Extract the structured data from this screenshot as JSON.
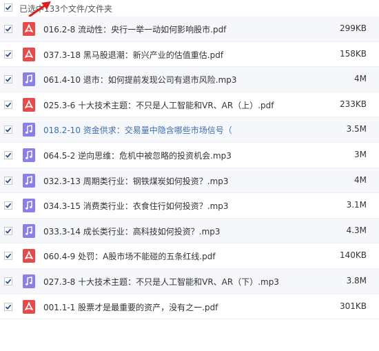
{
  "header": {
    "title": "已选中133个文件/文件夹"
  },
  "colors": {
    "pdf": "#e64a4a",
    "mp3": "#8b7ee8",
    "check": "#2a4b8d",
    "arrow": "#e01b1b"
  },
  "files": [
    {
      "name": "016.2-8 流动性：央行一举一动如何影响股市.pdf",
      "size": "299KB",
      "type": "pdf",
      "icon": "pdf-icon"
    },
    {
      "name": "037.3-18 黑马股退潮：新兴产业的估值重估.pdf",
      "size": "158KB",
      "type": "pdf",
      "icon": "pdf-icon"
    },
    {
      "name": "061.4-10 退市：如何提前发现公司有退市风险.mp3",
      "size": "4M",
      "type": "mp3",
      "icon": "music-note-icon"
    },
    {
      "name": "025.3-6 十大技术主题：不只是人工智能和VR、AR（上）.pdf",
      "size": "233KB",
      "type": "pdf",
      "icon": "pdf-icon"
    },
    {
      "name": "018.2-10 资金供求：交易量中隐含哪些市场信号（",
      "size": "3.5M",
      "type": "mp3",
      "icon": "music-note-icon"
    },
    {
      "name": "064.5-2 逆向思维：危机中被忽略的投资机会.mp3",
      "size": "3M",
      "type": "mp3",
      "icon": "music-note-icon"
    },
    {
      "name": "032.3-13 周期类行业：钢铁煤炭如何投资？.mp3",
      "size": "4M",
      "type": "mp3",
      "icon": "music-note-icon"
    },
    {
      "name": "034.3-15 消费类行业：衣食住行如何投资？.mp3",
      "size": "3.1M",
      "type": "mp3",
      "icon": "music-note-icon"
    },
    {
      "name": "033.3-14 成长类行业：高科技如何投资？.mp3",
      "size": "4.3M",
      "type": "mp3",
      "icon": "music-note-icon"
    },
    {
      "name": "060.4-9 处罚：A股市场不能碰的五条红线.pdf",
      "size": "140KB",
      "type": "pdf",
      "icon": "pdf-icon"
    },
    {
      "name": "027.3-8 十大技术主题：不只是人工智能和VR、AR（下）.mp3",
      "size": "3.8M",
      "type": "mp3",
      "icon": "music-note-icon"
    },
    {
      "name": "001.1-1 股票才是最重要的资产，没有之一.pdf",
      "size": "301KB",
      "type": "pdf",
      "icon": "pdf-icon"
    }
  ]
}
